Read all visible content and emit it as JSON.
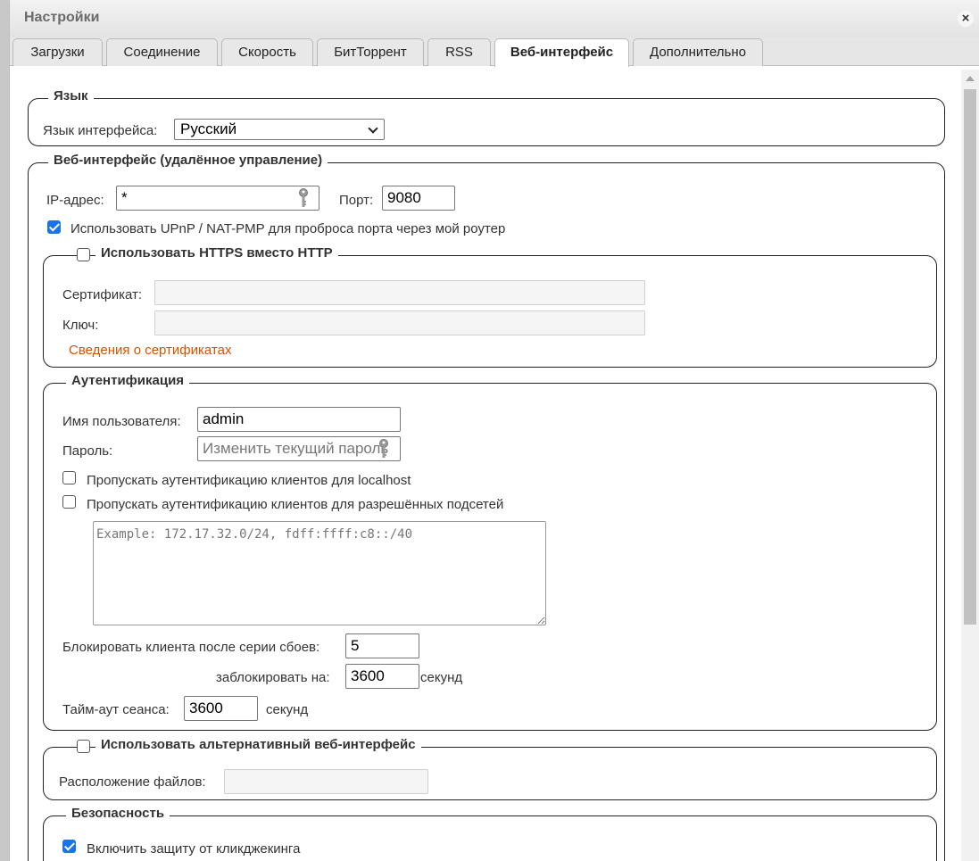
{
  "window": {
    "title": "Настройки"
  },
  "tabs": [
    {
      "label": "Загрузки"
    },
    {
      "label": "Соединение"
    },
    {
      "label": "Скорость"
    },
    {
      "label": "БитТоррент"
    },
    {
      "label": "RSS"
    },
    {
      "label": "Веб-интерфейс",
      "active": true
    },
    {
      "label": "Дополнительно"
    }
  ],
  "language": {
    "legend": "Язык",
    "interface_label": "Язык интерфейса:",
    "selected": "Русский"
  },
  "webui": {
    "legend": "Веб-интерфейс (удалённое управление)",
    "ip_label": "IP-адрес:",
    "ip_value": "*",
    "port_label": "Порт:",
    "port_value": "9080",
    "upnp_label": "Использовать UPnP / NAT-PMP для проброса порта через мой роутер",
    "upnp_checked": true
  },
  "https": {
    "legend": "Использовать HTTPS вместо HTTP",
    "checked": false,
    "cert_label": "Сертификат:",
    "key_label": "Ключ:",
    "info_link": "Сведения о сертификатах"
  },
  "auth": {
    "legend": "Аутентификация",
    "username_label": "Имя пользователя:",
    "username_value": "admin",
    "password_label": "Пароль:",
    "password_placeholder": "Изменить текущий пароль",
    "bypass_localhost_label": "Пропускать аутентификацию клиентов для localhost",
    "bypass_localhost_checked": false,
    "bypass_subnets_label": "Пропускать аутентификацию клиентов для разрешённых подсетей",
    "bypass_subnets_checked": false,
    "subnets_placeholder": "Example: 172.17.32.0/24, fdff:ffff:c8::/40",
    "ban_label": "Блокировать клиента после серии сбоев:",
    "ban_value": "5",
    "ban_duration_label": "заблокировать на:",
    "ban_duration_value": "3600",
    "ban_duration_unit": "секунд",
    "session_timeout_label": "Тайм-аут сеанса:",
    "session_timeout_value": "3600",
    "session_timeout_unit": "секунд"
  },
  "alt_webui": {
    "legend": "Использовать альтернативный веб-интерфейс",
    "checked": false,
    "files_location_label": "Расположение файлов:"
  },
  "security": {
    "legend": "Безопасность",
    "clickjacking_label": "Включить защиту от кликджекинга",
    "clickjacking_checked": true
  },
  "colors": {
    "link": "#d35400",
    "checkbox_checked": "#1a73e8"
  }
}
